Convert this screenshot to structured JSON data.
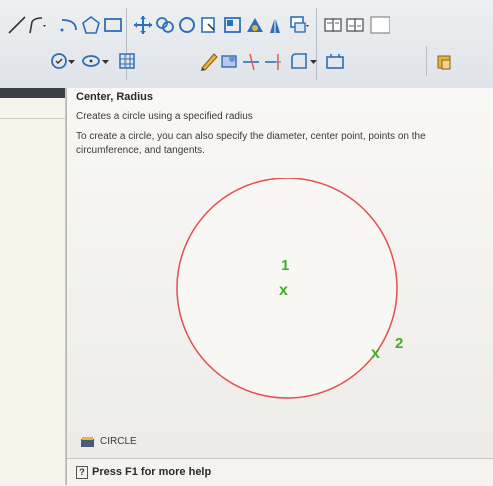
{
  "toolbar": {
    "row1_icons": [
      "line-icon",
      "polyline-icon",
      "arc-icon",
      "polygon-icon",
      "rectangle-icon",
      "move-icon",
      "copy-icon",
      "rotate-icon",
      "mirror-icon",
      "fillet-icon",
      "layer-icon",
      "layer-state-icon",
      "match-icon",
      "layer-props-icon",
      "layer-props2-icon"
    ],
    "row2_icons": [
      "circle-icon",
      "ellipse-icon",
      "hatch-icon",
      "pencil-icon",
      "stretch-icon",
      "trim-icon",
      "extend-icon",
      "boundary-icon",
      "window-icon",
      "layer-lock-icon"
    ],
    "accent_color": "#2d6fb8"
  },
  "tooltip": {
    "title": "Center, Radius",
    "subtitle": "Creates a circle using a specified radius",
    "description": "To create a circle, you can also specify the diameter, center point, points on the circumference, and tangents.",
    "figure": {
      "center_marker": "x",
      "center_label": "1",
      "edge_marker": "x",
      "edge_label": "2",
      "circle_color": "#e05050",
      "marker_color": "#3fae2a"
    },
    "command_icon": "circle-command-icon",
    "command": "CIRCLE",
    "help_icon": "?",
    "help": "Press F1 for more help"
  }
}
